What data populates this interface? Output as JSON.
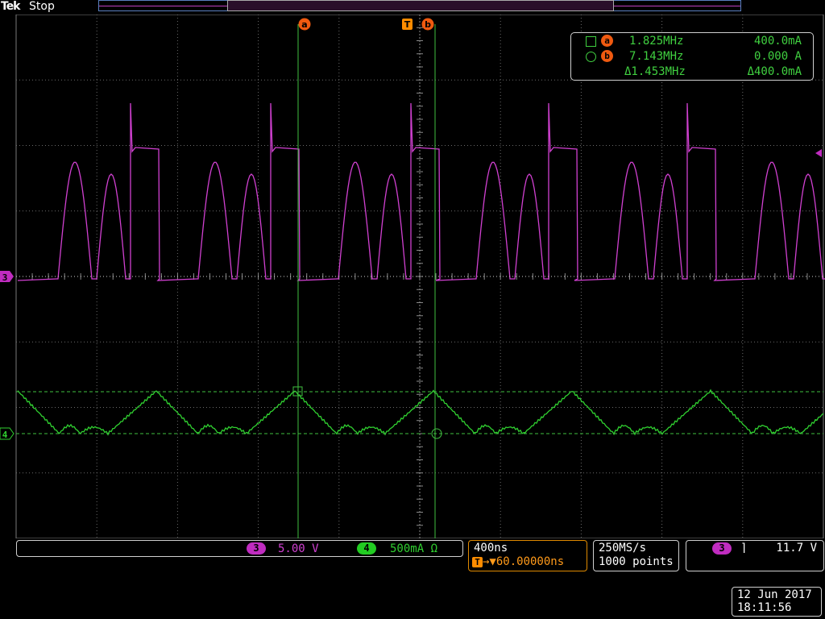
{
  "header": {
    "brand": "Tek",
    "state": "Stop"
  },
  "cursor_labels": {
    "a": "a",
    "b": "b",
    "trigger": "T"
  },
  "cursor_readout": {
    "row_a": {
      "marker": "square",
      "label": "a",
      "freq": "1.825MHz",
      "amp": "400.0mA"
    },
    "row_b": {
      "marker": "circle",
      "label": "b",
      "freq": "7.143MHz",
      "amp": "0.000 A"
    },
    "delta": {
      "freq": "Δ1.453MHz",
      "amp": "Δ400.0mA"
    }
  },
  "channels": {
    "ch3": {
      "number": "3",
      "scale": "5.00 V",
      "color": "#c02cc0"
    },
    "ch4": {
      "number": "4",
      "scale": "500mA Ω",
      "color": "#22cc22"
    }
  },
  "horizontal": {
    "scale": "400ns",
    "trigger_position_prefix": "T",
    "trigger_position": "→▼60.00000ns"
  },
  "acquisition": {
    "sample_rate": "250MS/s",
    "record_length": "1000 points"
  },
  "trigger": {
    "source": "3",
    "slope_symbol": "⌉",
    "level": "11.7 V"
  },
  "datetime": {
    "date": "12 Jun 2017",
    "time": "18:11:56"
  },
  "colors": {
    "grid": "#7a7a7a",
    "ch3": "#d040d0",
    "ch4": "#30d030",
    "cursor": "#40c040",
    "trigger": "#ff8c00"
  }
}
